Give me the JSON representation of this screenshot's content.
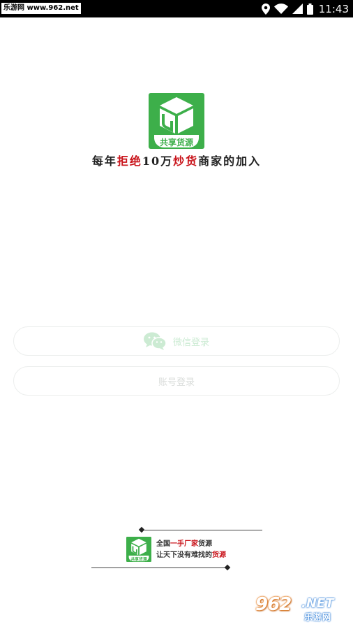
{
  "status_bar": {
    "watermark": "乐游网 www.962.net",
    "time": "11:43",
    "icons": [
      "location-icon",
      "wifi-icon",
      "signal-icon",
      "battery-icon"
    ]
  },
  "logo": {
    "text": "共享货源",
    "brand_color": "#3daf4a"
  },
  "tagline": {
    "p1": "每年",
    "h1": "拒绝",
    "p2": "10万",
    "h2": "炒货",
    "p3": "商家的加入",
    "highlight_color": "#c9141b"
  },
  "login": {
    "wechat_label": "微信登录",
    "account_label": "账号登录"
  },
  "footer": {
    "line1_a": "全国",
    "line1_b": "一手厂家",
    "line1_c": "货源",
    "line2_a": "让天下没有难找的",
    "line2_b": "货源",
    "logo_text": "共享货源"
  },
  "corner_badge": {
    "num": "962",
    "net": ".NET",
    "sub": "乐游网"
  }
}
